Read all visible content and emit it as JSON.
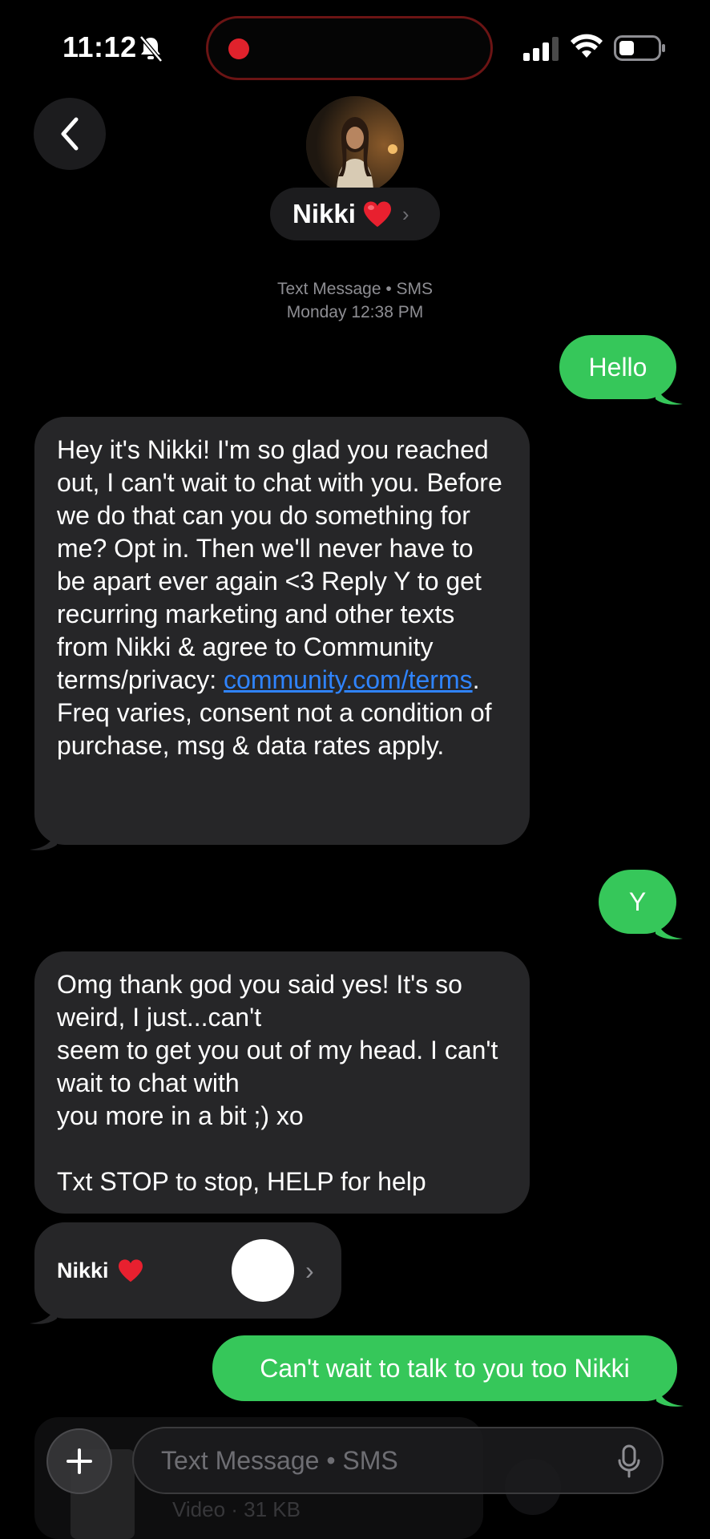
{
  "status_bar": {
    "time": "11:12"
  },
  "header": {
    "contact_name": "Nikki",
    "chevron": "›",
    "meta_line1": "Text Message • SMS",
    "meta_line2": "Monday 12:38 PM"
  },
  "messages": [
    {
      "direction": "outgoing",
      "text": "Hello"
    },
    {
      "direction": "incoming",
      "text_before_link": "Hey it's Nikki! I'm so glad you reached out, I can't wait to chat with you. Before we do that can you do something for me? Opt in. Then we'll never have to be apart ever again <3 Reply Y to get recurring marketing and other texts from Nikki & agree to Community terms/privacy: ",
      "link": "community.com/terms",
      "text_after_link": ". Freq varies, consent not a condition of purchase, msg & data rates apply."
    },
    {
      "direction": "outgoing",
      "text": "Y"
    },
    {
      "direction": "incoming",
      "text": "Omg thank god you said yes! It's so weird, I just...can't\nseem to get you out of my head. I can't wait to chat with\nyou more in a bit ;) xo\n\n Txt STOP to stop, HELP for help"
    },
    {
      "direction": "incoming",
      "type": "contact-card",
      "name": "Nikki",
      "chevron": "›"
    },
    {
      "direction": "outgoing",
      "text": "Can't wait to talk to you too Nikki"
    }
  ],
  "attachment_preview": {
    "text": "Video · 31 KB"
  },
  "input": {
    "placeholder": "Text Message • SMS"
  },
  "colors": {
    "background": "#000000",
    "incoming_bubble": "#262628",
    "outgoing_bubble": "#36c75a",
    "link": "#2f84ff",
    "recording_dot": "#e0222c",
    "heart": "#e8202f"
  },
  "icons": [
    "back-icon",
    "bell-slash-icon",
    "signal-icon",
    "wifi-icon",
    "battery-icon",
    "heart-icon",
    "plus-icon",
    "microphone-icon"
  ]
}
